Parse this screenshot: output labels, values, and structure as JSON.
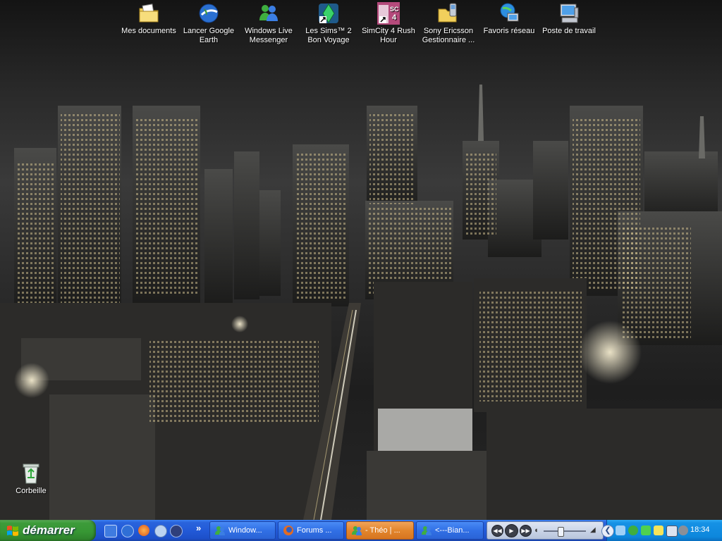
{
  "desktop": {
    "icons": [
      {
        "label": "Mes documents",
        "icon": "my-documents-icon"
      },
      {
        "label": "Lancer Google Earth",
        "icon": "google-earth-icon"
      },
      {
        "label": "Windows Live Messenger",
        "icon": "messenger-icon"
      },
      {
        "label": "Les Sims™ 2 Bon Voyage",
        "icon": "sims2-icon"
      },
      {
        "label": "SimCity 4 Rush Hour",
        "icon": "simcity4-icon"
      },
      {
        "label": "Sony Ericsson Gestionnaire ...",
        "icon": "sony-ericsson-icon"
      },
      {
        "label": "Favoris réseau",
        "icon": "network-places-icon"
      },
      {
        "label": "Poste de travail",
        "icon": "my-computer-icon"
      }
    ],
    "recycle_bin": {
      "label": "Corbeille",
      "icon": "recycle-bin-icon"
    }
  },
  "taskbar": {
    "start_label": "démarrer",
    "quick_launch": [
      "ie-icon",
      "firefox-icon",
      "itunes-icon",
      "media-player-icon"
    ],
    "overflow_label": "»",
    "windows": [
      {
        "label": "Window...",
        "icon": "messenger-icon",
        "active": false
      },
      {
        "label": "Forums ...",
        "icon": "firefox-icon",
        "active": false
      },
      {
        "label": "- Théo | ...",
        "icon": "messenger-icon",
        "active": true
      },
      {
        "label": "<---Bian...",
        "icon": "messenger-icon",
        "active": false
      }
    ],
    "media_player": {
      "controls": [
        "prev",
        "play",
        "next"
      ],
      "volume_icon": "speaker-icon"
    },
    "tray": {
      "icons": [
        "back-icon",
        "network-icon",
        "messenger-tray-icon",
        "shield-icon",
        "power-icon",
        "display-icon",
        "volume-tray-icon"
      ],
      "clock": "18:34"
    }
  },
  "colors": {
    "taskbar": "#225ad8",
    "start": "#379734",
    "tray": "#0d87dc",
    "active_window": "#e3862d"
  }
}
